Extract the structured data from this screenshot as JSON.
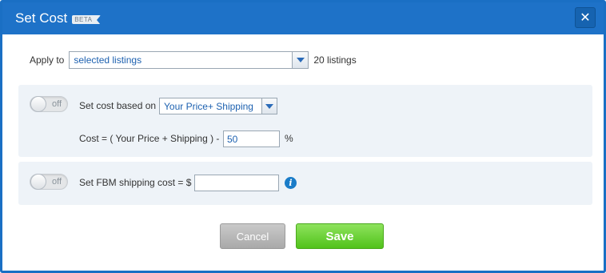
{
  "dialog": {
    "title": "Set Cost",
    "badge": "BETA",
    "close_icon": "close-icon"
  },
  "apply": {
    "label": "Apply to",
    "selected": "selected listings",
    "count": "20 listings"
  },
  "cost_section": {
    "toggle_state": "off",
    "label": "Set cost based on",
    "basis_selected": "Your Price+ Shipping",
    "formula_label": "Cost = ( Your Price + Shipping ) -",
    "percent_value": "50",
    "percent_unit": "%"
  },
  "shipping_section": {
    "toggle_state": "off",
    "label": "Set FBM shipping cost = $",
    "value": "",
    "info_icon": "info-icon"
  },
  "actions": {
    "cancel_label": "Cancel",
    "save_label": "Save"
  },
  "colors": {
    "titlebar": "#1e72c8",
    "save_button": "#51c21a",
    "cancel_button": "#a9a9a9",
    "panel_bg": "#eef3f8"
  }
}
